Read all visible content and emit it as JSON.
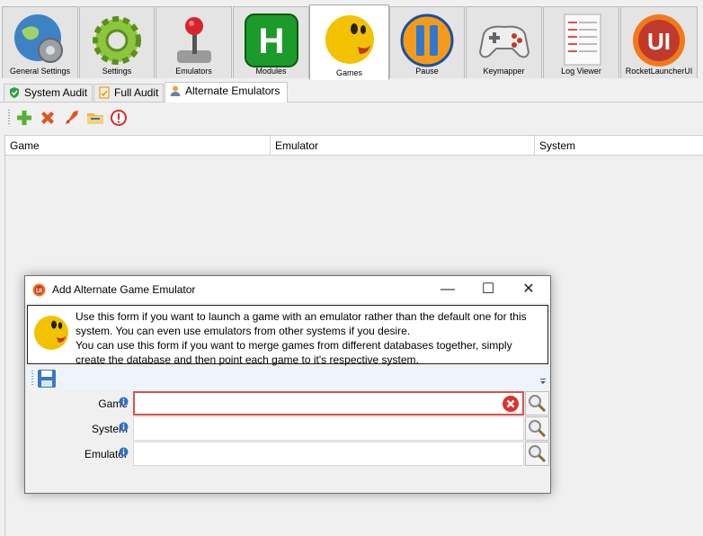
{
  "top_tabs": [
    {
      "label": "General Settings",
      "icon": "globe-gear-icon"
    },
    {
      "label": "Settings",
      "icon": "green-gear-icon"
    },
    {
      "label": "Emulators",
      "icon": "joystick-icon"
    },
    {
      "label": "Modules",
      "icon": "h-module-icon"
    },
    {
      "label": "Games",
      "icon": "pacman-icon",
      "active": true
    },
    {
      "label": "Pause",
      "icon": "pause-icon"
    },
    {
      "label": "Keymapper",
      "icon": "gamepad-icon"
    },
    {
      "label": "Log Viewer",
      "icon": "log-document-icon"
    },
    {
      "label": "RocketLauncherUI",
      "icon": "rocketlauncher-logo-icon"
    }
  ],
  "sub_tabs": [
    {
      "label": "System Audit",
      "icon": "shield-check-icon"
    },
    {
      "label": "Full Audit",
      "icon": "audit-document-icon"
    },
    {
      "label": "Alternate Emulators",
      "icon": "user-icon",
      "active": true
    }
  ],
  "toolbar": {
    "add": "add-icon",
    "delete": "delete-icon",
    "launch": "rocket-icon",
    "folder": "folder-icon",
    "stop": "stop-icon"
  },
  "grid": {
    "columns": [
      "Game",
      "Emulator",
      "System"
    ]
  },
  "dialog": {
    "title": "Add Alternate Game Emulator",
    "info_lines": [
      "Use this form if you want to launch a game with an emulator rather than the default one for this",
      "system. You can even use emulators from other systems if you desire.",
      "You can use this form if you want to merge games from different databases together, simply",
      "create the database and then point each game to it's respective system."
    ],
    "fields": [
      {
        "label": "Game",
        "value": "",
        "error": true
      },
      {
        "label": "System",
        "value": ""
      },
      {
        "label": "Emulator",
        "value": ""
      }
    ],
    "window_buttons": {
      "minimize": "—",
      "maximize": "☐",
      "close": "✕"
    }
  },
  "colors": {
    "error_border": "#d9534f",
    "accent_yellow": "#f2c200"
  }
}
